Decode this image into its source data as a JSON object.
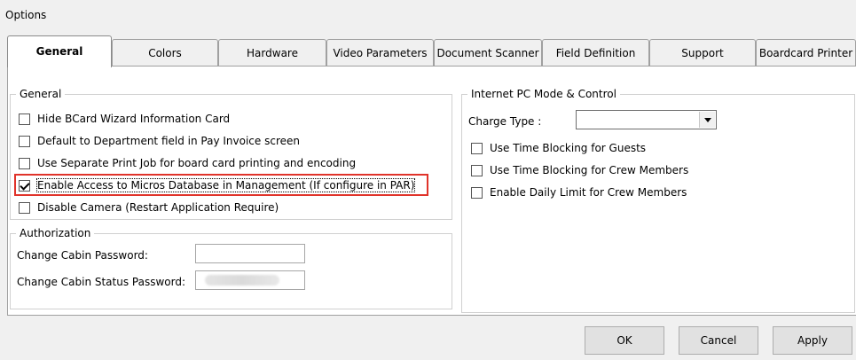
{
  "window": {
    "title": "Options"
  },
  "tabs": [
    {
      "label": "General",
      "active": true
    },
    {
      "label": "Colors"
    },
    {
      "label": "Hardware"
    },
    {
      "label": "Video Parameters"
    },
    {
      "label": "Document Scanner"
    },
    {
      "label": "Field Definition"
    },
    {
      "label": "Support"
    },
    {
      "label": "Boardcard Printer"
    }
  ],
  "general": {
    "legend": "General",
    "checkboxes": [
      {
        "label": "Hide BCard Wizard Information Card",
        "checked": false
      },
      {
        "label": "Default to Department field in Pay Invoice screen",
        "checked": false
      },
      {
        "label": "Use Separate Print Job for board card printing and encoding",
        "checked": false
      },
      {
        "label": "Enable Access to Micros Database in Management (If configure in PAR)",
        "checked": true
      },
      {
        "label": "Disable Camera (Restart Application Require)",
        "checked": false
      }
    ]
  },
  "authorization": {
    "legend": "Authorization",
    "change_cabin_password_label": "Change Cabin Password:",
    "change_cabin_password_value": "",
    "change_cabin_status_password_label": "Change Cabin Status Password:",
    "change_cabin_status_password_value": ""
  },
  "internet": {
    "legend": "Internet PC Mode & Control",
    "charge_type_label": "Charge Type :",
    "charge_type_value": "",
    "checkboxes": [
      {
        "label": "Use Time Blocking for Guests",
        "checked": false
      },
      {
        "label": "Use Time Blocking for Crew Members",
        "checked": false
      },
      {
        "label": "Enable Daily Limit for Crew Members",
        "checked": false
      }
    ]
  },
  "buttons": {
    "ok": "OK",
    "cancel": "Cancel",
    "apply": "Apply"
  },
  "colors": {
    "highlight": "#e0332a"
  }
}
